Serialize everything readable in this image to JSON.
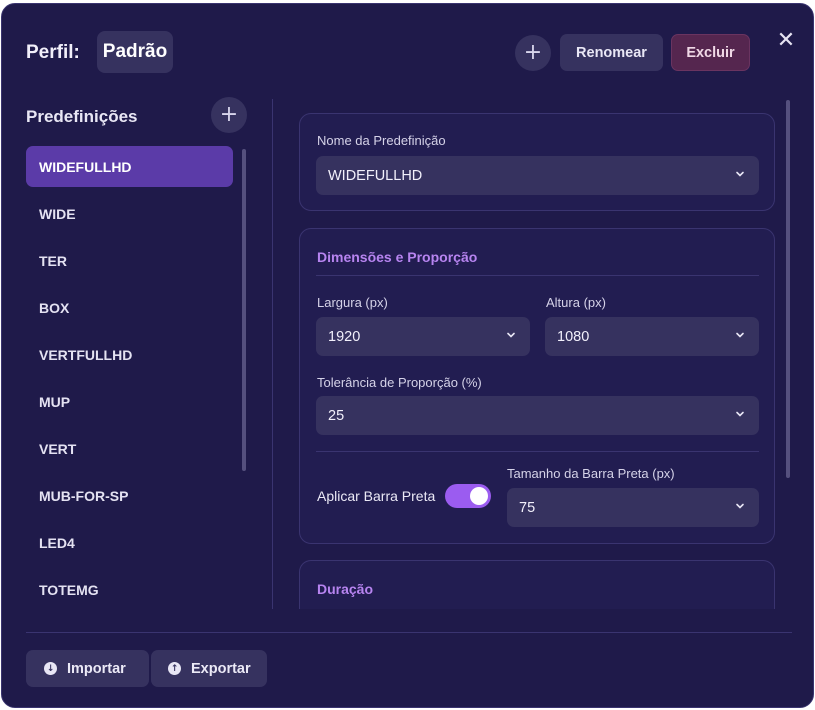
{
  "header": {
    "title": "Perfil:",
    "profile_name": "Padrão",
    "add_icon": "plus-icon",
    "rename_label": "Renomear",
    "delete_label": "Excluir",
    "close_icon": "close-icon"
  },
  "sidebar": {
    "title": "Predefinições",
    "add_icon": "plus-icon",
    "items": [
      {
        "label": "WIDEFULLHD",
        "active": true
      },
      {
        "label": "WIDE"
      },
      {
        "label": "TER"
      },
      {
        "label": "BOX"
      },
      {
        "label": "VERTFULLHD"
      },
      {
        "label": "MUP"
      },
      {
        "label": "VERT"
      },
      {
        "label": "MUB-FOR-SP"
      },
      {
        "label": "LED4"
      },
      {
        "label": "TOTEMG"
      }
    ]
  },
  "main": {
    "preset_name_label": "Nome da Predefinição",
    "preset_name_value": "WIDEFULLHD",
    "dimensions_title": "Dimensões e Proporção",
    "width_label": "Largura (px)",
    "width_value": "1920",
    "height_label": "Altura (px)",
    "height_value": "1080",
    "tolerance_label": "Tolerância de Proporção (%)",
    "tolerance_value": "25",
    "apply_black_bar_label": "Aplicar Barra Preta",
    "apply_black_bar_on": true,
    "black_bar_size_label": "Tamanho da Barra Preta (px)",
    "black_bar_size_value": "75",
    "duration_title": "Duração"
  },
  "footer": {
    "import_label": "Importar",
    "import_icon": "download-circle-icon",
    "export_label": "Exportar",
    "export_icon": "upload-circle-icon"
  },
  "colors": {
    "background": "#1f1a4a",
    "active_item": "#5b3ba8",
    "accent": "#9b5cf0",
    "section_title": "#b784f0",
    "delete_button": "#55264f"
  }
}
